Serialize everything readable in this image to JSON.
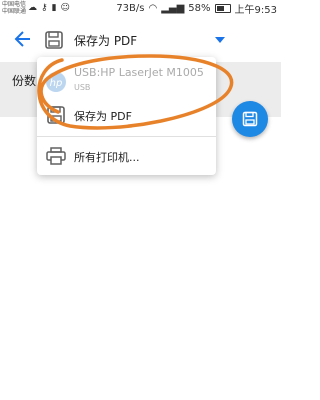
{
  "status_bar": {
    "carrier_line1": "中国电信",
    "carrier_line2": "中国联通",
    "speed": "73B/s",
    "battery": "58%",
    "time": "上午9:53"
  },
  "app_bar": {
    "printer_select_label": "保存为 PDF"
  },
  "settings": {
    "copies_label": "份数"
  },
  "menu": {
    "items": [
      {
        "label": "USB:HP LaserJet M1005",
        "sublabel": "USB",
        "icon": "hp-logo-icon"
      },
      {
        "label": "保存为 PDF",
        "icon": "pdf-save-icon"
      },
      {
        "label": "所有打印机...",
        "icon": "printer-icon"
      }
    ]
  },
  "colors": {
    "accent": "#1a73e8",
    "fab": "#1e88e5",
    "annotation": "#e8822a"
  }
}
